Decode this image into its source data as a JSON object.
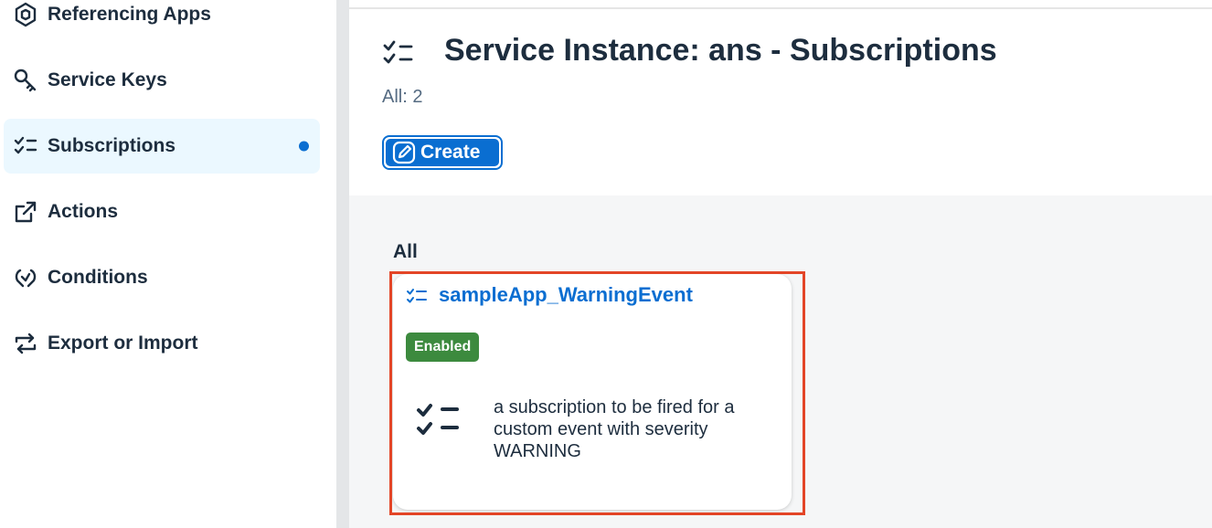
{
  "sidebar": {
    "items": [
      {
        "label": "Referencing Apps",
        "icon": "hexagon-app-icon"
      },
      {
        "label": "Service Keys",
        "icon": "key-icon"
      },
      {
        "label": "Subscriptions",
        "icon": "checklist-icon",
        "selected": true
      },
      {
        "label": "Actions",
        "icon": "share-box-icon"
      },
      {
        "label": "Conditions",
        "icon": "condition-icon"
      },
      {
        "label": "Export or Import",
        "icon": "sync-arrows-icon"
      }
    ]
  },
  "header": {
    "title": "Service Instance: ans - Subscriptions",
    "count": "All: 2",
    "create_label": "Create"
  },
  "content": {
    "section_label": "All",
    "cards": [
      {
        "title": "sampleApp_WarningEvent",
        "status": "Enabled",
        "description": "a subscription to be fired for a custom event with severity WARNING"
      }
    ]
  },
  "colors": {
    "accent": "#0a6ed1",
    "selected_bg": "#ebf8ff",
    "status_enabled": "#3c8a3e",
    "highlight": "#e34527",
    "text": "#1d2d3e"
  }
}
